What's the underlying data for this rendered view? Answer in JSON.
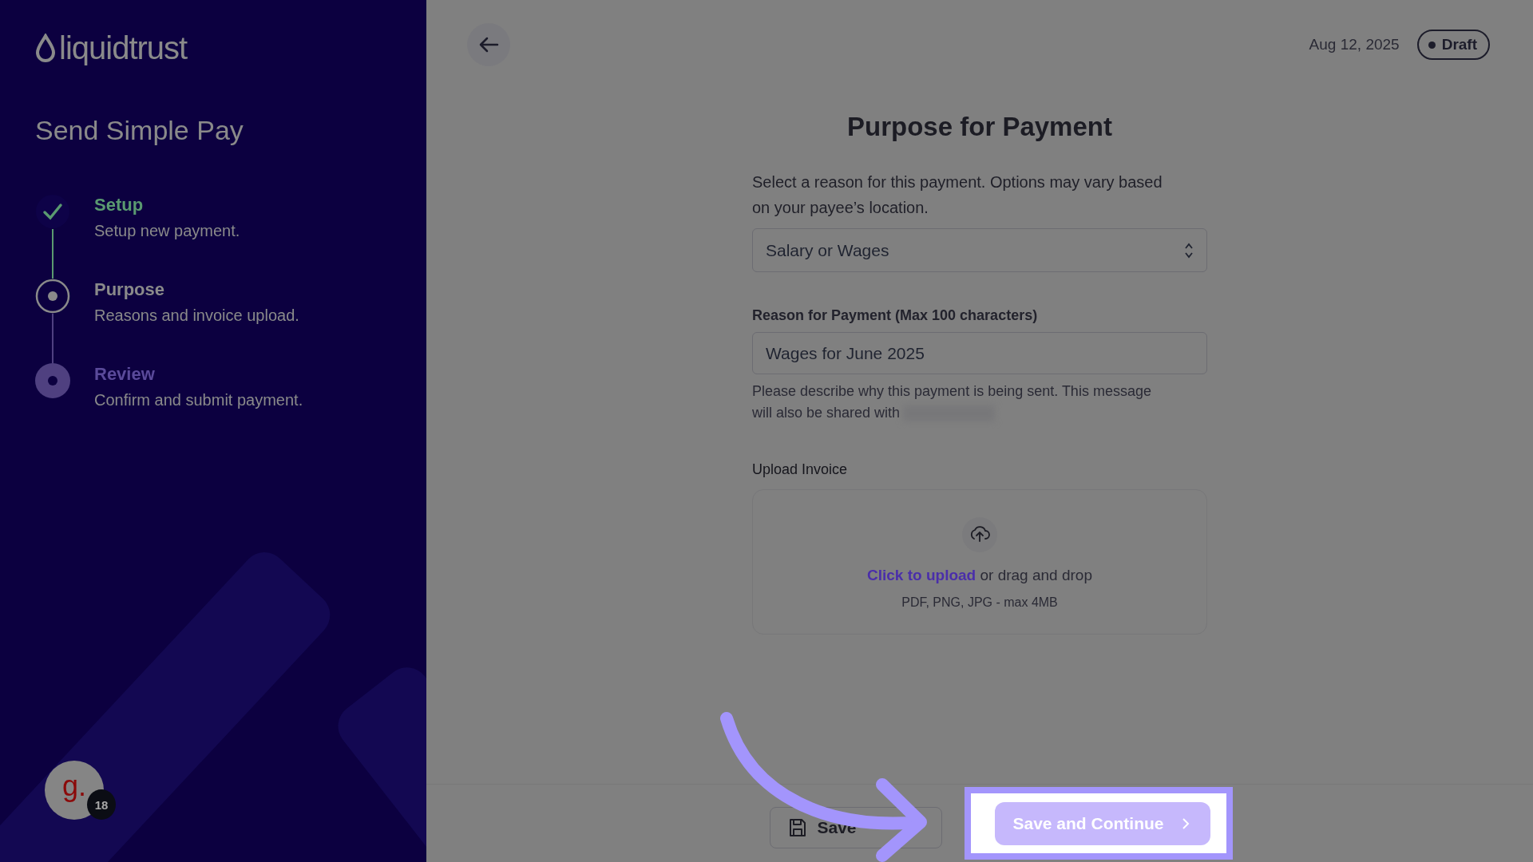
{
  "sidebar": {
    "logo": "liquidtrust",
    "title": "Send Simple Pay",
    "steps": [
      {
        "title": "Setup",
        "subtitle": "Setup new payment.",
        "kind": "done"
      },
      {
        "title": "Purpose",
        "subtitle": "Reasons and invoice upload.",
        "kind": "current"
      },
      {
        "title": "Review",
        "subtitle": "Confirm and submit payment.",
        "kind": "upcoming"
      }
    ],
    "avatar": {
      "initial": "g.",
      "badge": "18"
    }
  },
  "header": {
    "date": "Aug 12, 2025",
    "status": "Draft"
  },
  "form": {
    "title": "Purpose for Payment",
    "intro": "Select a reason for this payment. Options may vary based on your payee’s location.",
    "reason_select": {
      "value": "Salary or Wages"
    },
    "reason_field": {
      "label": "Reason for Payment (Max 100 characters)",
      "value": "Wages for June 2025",
      "help": "Please describe why this payment is being sent. This message will also be shared with"
    },
    "upload": {
      "label": "Upload Invoice",
      "link": "Click to upload",
      "text": "or drag and drop",
      "hint": "PDF, PNG, JPG - max 4MB"
    }
  },
  "footer": {
    "buttons": [
      {
        "label": "Save",
        "kind": "secondary",
        "highlighted": false
      },
      {
        "label": "Save and Continue",
        "kind": "primary",
        "highlighted": true
      }
    ]
  }
}
